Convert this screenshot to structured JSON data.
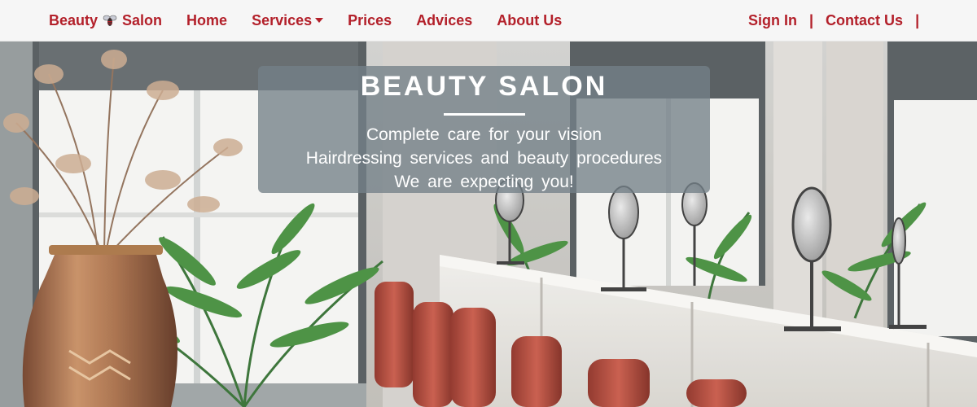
{
  "nav": {
    "brand_left": "Beauty",
    "brand_right": "Salon",
    "brand_icon": "bee-icon",
    "items": [
      {
        "label": "Home"
      },
      {
        "label": "Services",
        "has_dropdown": true
      },
      {
        "label": "Prices"
      },
      {
        "label": "Advices"
      },
      {
        "label": "About Us"
      }
    ],
    "right": {
      "sign_in": "Sign In",
      "contact": "Contact Us",
      "separator": "|"
    },
    "accent_color": "#b3202a"
  },
  "hero": {
    "title": "BEAUTY SALON",
    "lines": [
      "Complete care for your vision",
      "Hairdressing services and beauty procedures",
      "We are expecting you!"
    ]
  }
}
